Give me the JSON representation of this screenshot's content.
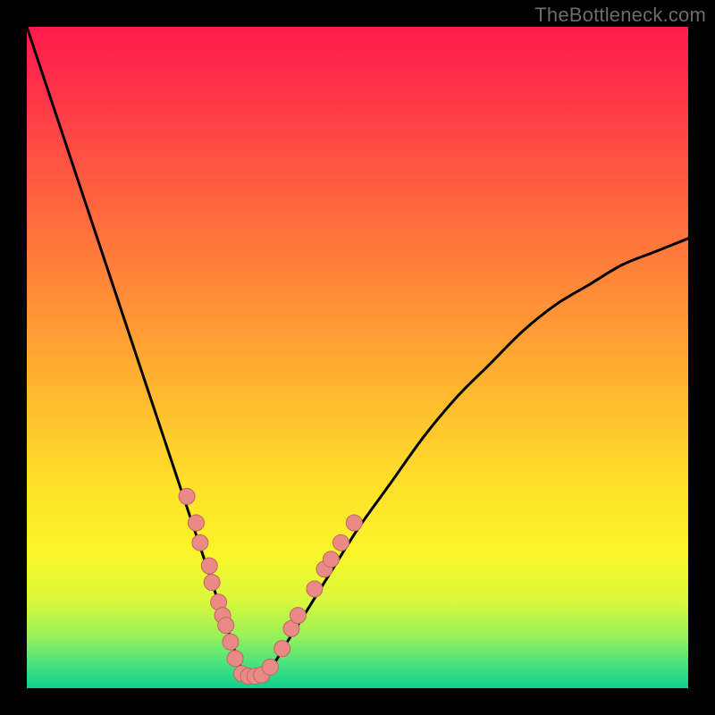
{
  "watermark": "TheBottleneck.com",
  "colors": {
    "frame_bg": "#000000",
    "curve_stroke": "#000000",
    "dot_fill": "#e98a86",
    "dot_stroke": "#c26762"
  },
  "chart_data": {
    "type": "line",
    "title": "",
    "xlabel": "",
    "ylabel": "",
    "xlim": [
      0,
      100
    ],
    "ylim": [
      0,
      100
    ],
    "grid": false,
    "legend": false,
    "curve_note": "V-shaped bottleneck curve; y is percent deviation, x is relative component value. Minimum near x≈33.",
    "series": [
      {
        "name": "bottleneck-curve",
        "x": [
          0,
          3,
          6,
          9,
          12,
          15,
          18,
          21,
          24,
          27,
          30,
          33,
          36,
          40,
          45,
          50,
          55,
          60,
          65,
          70,
          75,
          80,
          85,
          90,
          95,
          100
        ],
        "values": [
          100,
          91,
          82,
          73,
          64,
          55,
          46,
          37,
          28,
          19,
          10,
          2,
          2,
          8,
          16,
          24,
          31,
          38,
          44,
          49,
          54,
          58,
          61,
          64,
          66,
          68
        ]
      }
    ],
    "dots_note": "Salmon dots mark sampled points along the bottom of the curve.",
    "dots": [
      {
        "x": 24.2,
        "y": 29.0
      },
      {
        "x": 25.6,
        "y": 25.0
      },
      {
        "x": 26.2,
        "y": 22.0
      },
      {
        "x": 27.6,
        "y": 18.5
      },
      {
        "x": 28.0,
        "y": 16.0
      },
      {
        "x": 29.0,
        "y": 13.0
      },
      {
        "x": 29.6,
        "y": 11.0
      },
      {
        "x": 30.1,
        "y": 9.5
      },
      {
        "x": 30.8,
        "y": 7.0
      },
      {
        "x": 31.5,
        "y": 4.5
      },
      {
        "x": 32.5,
        "y": 2.2
      },
      {
        "x": 33.5,
        "y": 1.8
      },
      {
        "x": 34.5,
        "y": 1.8
      },
      {
        "x": 35.5,
        "y": 2.0
      },
      {
        "x": 36.8,
        "y": 3.2
      },
      {
        "x": 38.6,
        "y": 6.0
      },
      {
        "x": 40.0,
        "y": 9.0
      },
      {
        "x": 41.0,
        "y": 11.0
      },
      {
        "x": 43.5,
        "y": 15.0
      },
      {
        "x": 45.0,
        "y": 18.0
      },
      {
        "x": 46.0,
        "y": 19.5
      },
      {
        "x": 47.5,
        "y": 22.0
      },
      {
        "x": 49.5,
        "y": 25.0
      }
    ]
  }
}
